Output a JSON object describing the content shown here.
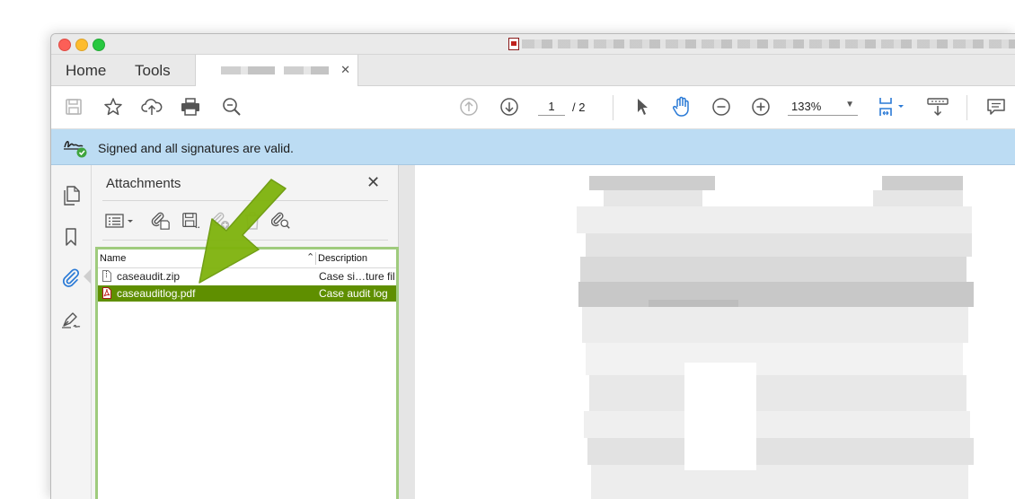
{
  "window": {
    "tabs": {
      "home": "Home",
      "tools": "Tools"
    }
  },
  "toolbar": {
    "page_current": "1",
    "page_total": "/ 2",
    "zoom": "133%",
    "icons": [
      "save-icon",
      "star-icon",
      "upload-cloud-icon",
      "print-icon",
      "search-zoom-icon",
      "page-up-icon",
      "page-down-icon",
      "select-cursor-icon",
      "hand-icon",
      "zoom-out-icon",
      "zoom-in-icon",
      "fit-page-icon",
      "keyboard-icon",
      "comment-icon"
    ]
  },
  "signature_bar": {
    "message": "Signed and all signatures are valid."
  },
  "sidebar": {
    "icons": [
      "pages-icon",
      "bookmark-icon",
      "attachment-icon",
      "signature-pen-icon"
    ]
  },
  "attachments": {
    "title": "Attachments",
    "columns": {
      "name": "Name",
      "description": "Description"
    },
    "rows": [
      {
        "name": "caseaudit.zip",
        "description": "Case si…ture fil",
        "icon": "file-icon",
        "selected": false
      },
      {
        "name": "caseauditlog.pdf",
        "description": "Case audit log",
        "icon": "pdf-file-icon",
        "selected": true
      }
    ]
  },
  "colors": {
    "signature_bar": "#bcdcf3",
    "selected_row": "#5f8f00",
    "highlight_border": "#9fcb7d",
    "callout_arrow": "#7fb30d",
    "accent_blue": "#2a7ad6"
  }
}
